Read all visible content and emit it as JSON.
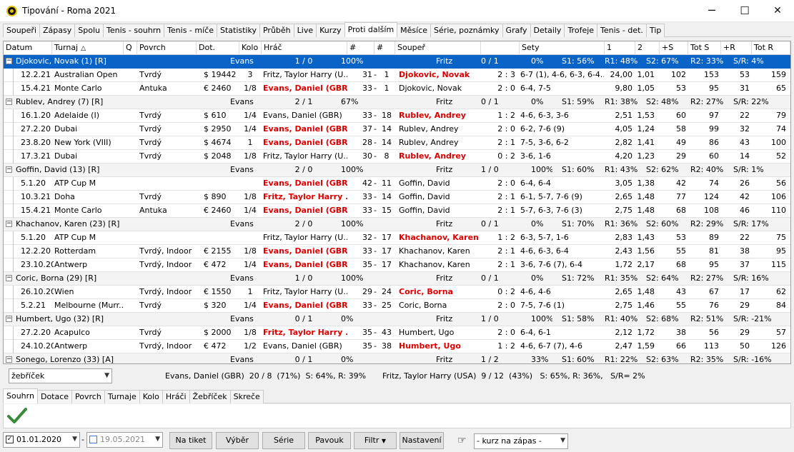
{
  "window": {
    "title": "Tipování - Roma 2021",
    "min": "─",
    "max": "☐",
    "close": "✕"
  },
  "tabs": [
    "Soupeři",
    "Zápasy",
    "Spolu",
    "Tenis - souhrn",
    "Tenis - míče",
    "Statistiky",
    "Průběh",
    "Live",
    "Kurzy",
    "Proti dalším",
    "Měsíce",
    "Série, poznámky",
    "Grafy",
    "Detaily",
    "Trofeje",
    "Tenis - det.",
    "Tip"
  ],
  "active_tab": "Proti dalším",
  "columns": [
    "Datum",
    "Turnaj",
    "Q",
    "Povrch",
    "Dot.",
    "Kolo",
    "Hráč",
    "#",
    "#",
    "Soupeř",
    "",
    "Sety",
    "1",
    "2",
    "+S",
    "Tot S",
    "+R",
    "Tot R"
  ],
  "groups": [
    {
      "name": "Djokovic, Novak (1) [R]",
      "a_name": "Evans",
      "a_score": "1 / 0",
      "a_pct": "100%",
      "b_name": "Fritz",
      "b_score": "0 / 1",
      "b_pct": "0%",
      "s1": "S1: 56%",
      "r1": "R1: 48%",
      "s2": "S2: 67%",
      "r2": "R2: 33%",
      "sr": "S/R: 4%",
      "selected": true,
      "rows": [
        {
          "date": "12.2.21",
          "tour": "Australian Open",
          "surf": "Tvrdý",
          "prize": "$ 19442",
          "round": "3",
          "player": "Fritz, Taylor Harry (U...",
          "pred": false,
          "r1": "31",
          "r2": "1",
          "opp": "Djokovic, Novak",
          "ored": true,
          "score": "2 : 3",
          "sets": "6-7 (1), 4-6, 6-3, 6-4...",
          "o1": "24,00",
          "o2": "1,01",
          "ps": "102",
          "ts": "153",
          "pr": "53",
          "tr": "159"
        },
        {
          "date": "15.4.21",
          "tour": "Monte Carlo",
          "surf": "Antuka",
          "prize": "€ 2460",
          "round": "1/8",
          "player": "Evans, Daniel (GBR)",
          "pred": true,
          "r1": "33",
          "r2": "1",
          "opp": "Djokovic, Novak",
          "ored": false,
          "score": "2 : 0",
          "sets": "6-4, 7-5",
          "o1": "9,80",
          "o2": "1,05",
          "ps": "53",
          "ts": "95",
          "pr": "31",
          "tr": "65"
        }
      ]
    },
    {
      "name": "Rublev, Andrey (7) [R]",
      "a_name": "Evans",
      "a_score": "2 / 1",
      "a_pct": "67%",
      "b_name": "Fritz",
      "b_score": "0 / 1",
      "b_pct": "0%",
      "s1": "S1: 59%",
      "r1": "R1: 38%",
      "s2": "S2: 48%",
      "r2": "R2: 27%",
      "sr": "S/R: 22%",
      "selected": false,
      "rows": [
        {
          "date": "16.1.20",
          "tour": "Adelaide (I)",
          "surf": "Tvrdý",
          "prize": "$ 610",
          "round": "1/4",
          "player": "Evans, Daniel (GBR)",
          "pred": false,
          "r1": "33",
          "r2": "18",
          "opp": "Rublev, Andrey",
          "ored": true,
          "score": "1 : 2",
          "sets": "4-6, 6-3, 3-6",
          "o1": "2,51",
          "o2": "1,53",
          "ps": "60",
          "ts": "97",
          "pr": "22",
          "tr": "79"
        },
        {
          "date": "27.2.20",
          "tour": "Dubai",
          "surf": "Tvrdý",
          "prize": "$ 2950",
          "round": "1/4",
          "player": "Evans, Daniel (GBR)",
          "pred": true,
          "r1": "37",
          "r2": "14",
          "opp": "Rublev, Andrey",
          "ored": false,
          "score": "2 : 0",
          "sets": "6-2, 7-6 (9)",
          "o1": "4,05",
          "o2": "1,24",
          "ps": "58",
          "ts": "99",
          "pr": "32",
          "tr": "74"
        },
        {
          "date": "23.8.20",
          "tour": "New York (VIII)",
          "surf": "Tvrdý",
          "prize": "$ 4674",
          "round": "1",
          "player": "Evans, Daniel (GBR)",
          "pred": true,
          "r1": "28",
          "r2": "14",
          "opp": "Rublev, Andrey",
          "ored": false,
          "score": "2 : 1",
          "sets": "7-5, 3-6, 6-2",
          "o1": "2,82",
          "o2": "1,41",
          "ps": "49",
          "ts": "86",
          "pr": "43",
          "tr": "100"
        },
        {
          "date": "17.3.21",
          "tour": "Dubai",
          "surf": "Tvrdý",
          "prize": "$ 2048",
          "round": "1/8",
          "player": "Fritz, Taylor Harry (U...",
          "pred": false,
          "r1": "30",
          "r2": "8",
          "opp": "Rublev, Andrey",
          "ored": true,
          "score": "0 : 2",
          "sets": "3-6, 1-6",
          "o1": "4,20",
          "o2": "1,23",
          "ps": "29",
          "ts": "60",
          "pr": "14",
          "tr": "52"
        }
      ]
    },
    {
      "name": "Goffin, David (13) [R]",
      "a_name": "Evans",
      "a_score": "2 / 0",
      "a_pct": "100%",
      "b_name": "Fritz",
      "b_score": "1 / 0",
      "b_pct": "100%",
      "s1": "S1: 60%",
      "r1": "R1: 43%",
      "s2": "S2: 62%",
      "r2": "R2: 40%",
      "sr": "S/R: 1%",
      "selected": false,
      "rows": [
        {
          "date": "5.1.20",
          "tour": "ATP Cup M",
          "surf": "",
          "prize": "",
          "round": "",
          "player": "Evans, Daniel (GBR)",
          "pred": true,
          "r1": "42",
          "r2": "11",
          "opp": "Goffin, David",
          "ored": false,
          "score": "2 : 0",
          "sets": "6-4, 6-4",
          "o1": "3,05",
          "o2": "1,38",
          "ps": "42",
          "ts": "74",
          "pr": "26",
          "tr": "56"
        },
        {
          "date": "10.3.21",
          "tour": "Doha",
          "surf": "Tvrdý",
          "prize": "$ 890",
          "round": "1/8",
          "player": "Fritz, Taylor Harry ...",
          "pred": true,
          "r1": "33",
          "r2": "14",
          "opp": "Goffin, David",
          "ored": false,
          "score": "2 : 1",
          "sets": "6-1, 5-7, 7-6 (9)",
          "o1": "2,65",
          "o2": "1,48",
          "ps": "77",
          "ts": "124",
          "pr": "42",
          "tr": "106"
        },
        {
          "date": "15.4.21",
          "tour": "Monte Carlo",
          "surf": "Antuka",
          "prize": "€ 2460",
          "round": "1/4",
          "player": "Evans, Daniel (GBR)",
          "pred": true,
          "r1": "33",
          "r2": "15",
          "opp": "Goffin, David",
          "ored": false,
          "score": "2 : 1",
          "sets": "5-7, 6-3, 7-6 (3)",
          "o1": "2,75",
          "o2": "1,48",
          "ps": "68",
          "ts": "108",
          "pr": "46",
          "tr": "110"
        }
      ]
    },
    {
      "name": "Khachanov, Karen (23) [R]",
      "a_name": "Evans",
      "a_score": "2 / 0",
      "a_pct": "100%",
      "b_name": "Fritz",
      "b_score": "0 / 1",
      "b_pct": "0%",
      "s1": "S1: 70%",
      "r1": "R1: 36%",
      "s2": "S2: 60%",
      "r2": "R2: 29%",
      "sr": "S/R: 17%",
      "selected": false,
      "rows": [
        {
          "date": "5.1.20",
          "tour": "ATP Cup M",
          "surf": "",
          "prize": "",
          "round": "",
          "player": "Fritz, Taylor Harry (U...",
          "pred": false,
          "r1": "32",
          "r2": "17",
          "opp": "Khachanov, Karen",
          "ored": true,
          "score": "1 : 2",
          "sets": "6-3, 5-7, 1-6",
          "o1": "2,83",
          "o2": "1,43",
          "ps": "53",
          "ts": "89",
          "pr": "22",
          "tr": "75"
        },
        {
          "date": "12.2.20",
          "tour": "Rotterdam",
          "surf": "Tvrdý, Indoor",
          "prize": "€ 2155",
          "round": "1/8",
          "player": "Evans, Daniel (GBR)",
          "pred": true,
          "r1": "33",
          "r2": "17",
          "opp": "Khachanov, Karen",
          "ored": false,
          "score": "2 : 1",
          "sets": "4-6, 6-3, 6-4",
          "o1": "2,43",
          "o2": "1,56",
          "ps": "55",
          "ts": "81",
          "pr": "38",
          "tr": "95"
        },
        {
          "date": "23.10.20",
          "tour": "Antwerp",
          "surf": "Tvrdý, Indoor",
          "prize": "€ 472",
          "round": "1/4",
          "player": "Evans, Daniel (GBR)",
          "pred": true,
          "r1": "35",
          "r2": "17",
          "opp": "Khachanov, Karen",
          "ored": false,
          "score": "2 : 1",
          "sets": "3-6, 7-6 (7), 6-4",
          "o1": "1,72",
          "o2": "2,17",
          "ps": "68",
          "ts": "95",
          "pr": "37",
          "tr": "115"
        }
      ]
    },
    {
      "name": "Coric, Borna (29) [R]",
      "a_name": "Evans",
      "a_score": "1 / 0",
      "a_pct": "100%",
      "b_name": "Fritz",
      "b_score": "0 / 1",
      "b_pct": "0%",
      "s1": "S1: 72%",
      "r1": "R1: 35%",
      "s2": "S2: 64%",
      "r2": "R2: 27%",
      "sr": "S/R: 16%",
      "selected": false,
      "rows": [
        {
          "date": "26.10.20",
          "tour": "Wien",
          "surf": "Tvrdý, Indoor",
          "prize": "€ 1550",
          "round": "1",
          "player": "Fritz, Taylor Harry (U...",
          "pred": false,
          "r1": "29",
          "r2": "24",
          "opp": "Coric, Borna",
          "ored": true,
          "score": "0 : 2",
          "sets": "4-6, 4-6",
          "o1": "2,65",
          "o2": "1,48",
          "ps": "43",
          "ts": "67",
          "pr": "17",
          "tr": "62"
        },
        {
          "date": "5.2.21",
          "tour": "Melbourne (Murr...",
          "surf": "Tvrdý",
          "prize": "$ 320",
          "round": "1/4",
          "player": "Evans, Daniel (GBR)",
          "pred": true,
          "r1": "33",
          "r2": "25",
          "opp": "Coric, Borna",
          "ored": false,
          "score": "2 : 0",
          "sets": "7-5, 7-6 (1)",
          "o1": "2,75",
          "o2": "1,46",
          "ps": "55",
          "ts": "76",
          "pr": "29",
          "tr": "84"
        }
      ]
    },
    {
      "name": "Humbert, Ugo (32) [R]",
      "a_name": "Evans",
      "a_score": "0 / 1",
      "a_pct": "0%",
      "b_name": "Fritz",
      "b_score": "1 / 0",
      "b_pct": "100%",
      "s1": "S1: 58%",
      "r1": "R1: 40%",
      "s2": "S2: 68%",
      "r2": "R2: 51%",
      "sr": "S/R: -21%",
      "selected": false,
      "rows": [
        {
          "date": "27.2.20",
          "tour": "Acapulco",
          "surf": "Tvrdý",
          "prize": "$ 2000",
          "round": "1/8",
          "player": "Fritz, Taylor Harry ...",
          "pred": true,
          "r1": "35",
          "r2": "43",
          "opp": "Humbert, Ugo",
          "ored": false,
          "score": "2 : 0",
          "sets": "6-4, 6-1",
          "o1": "2,12",
          "o2": "1,72",
          "ps": "38",
          "ts": "56",
          "pr": "29",
          "tr": "57"
        },
        {
          "date": "24.10.20",
          "tour": "Antwerp",
          "surf": "Tvrdý, Indoor",
          "prize": "€ 472",
          "round": "1/2",
          "player": "Evans, Daniel (GBR)",
          "pred": false,
          "r1": "35",
          "r2": "38",
          "opp": "Humbert, Ugo",
          "ored": true,
          "score": "1 : 2",
          "sets": "4-6, 6-7 (7), 4-6",
          "o1": "2,47",
          "o2": "1,59",
          "ps": "66",
          "ts": "113",
          "pr": "50",
          "tr": "126"
        }
      ]
    },
    {
      "name": "Sonego, Lorenzo (33) [A]",
      "a_name": "Evans",
      "a_score": "0 / 1",
      "a_pct": "0%",
      "b_name": "Fritz",
      "b_score": "1 / 2",
      "b_pct": "33%",
      "s1": "S1: 60%",
      "r1": "R1: 22%",
      "s2": "S2: 63%",
      "r2": "R2: 35%",
      "sr": "S/R: -16%",
      "selected": false,
      "rows": []
    }
  ],
  "summary": {
    "combo": "žebříček",
    "a": "Evans, Daniel (GBR)  20 / 8  (71%)  S: 64%, R: 39%",
    "b": "Fritz, Taylor Harry (USA)  9 / 12  (43%)   S: 65%, R: 36%,   S/R= 2%"
  },
  "bottom_tabs": [
    "Souhrn",
    "Dotace",
    "Povrch",
    "Turnaje",
    "Kolo",
    "Hráči",
    "Žebříček",
    "Skreče"
  ],
  "bottom_active": "Souhrn",
  "footer": {
    "date_from": "01.01.2020",
    "date_to": "19.05.2021",
    "btn_ticket": "Na tiket",
    "btn_select": "Výběr",
    "btn_series": "Série",
    "btn_pavouk": "Pavouk",
    "btn_filter": "Filtr",
    "btn_settings": "Nastavení",
    "odds_combo": "- kurz na zápas -"
  },
  "colors": {
    "selection": "#0a64c8",
    "highlight": "#e00000",
    "check": "#3a8a3a"
  }
}
